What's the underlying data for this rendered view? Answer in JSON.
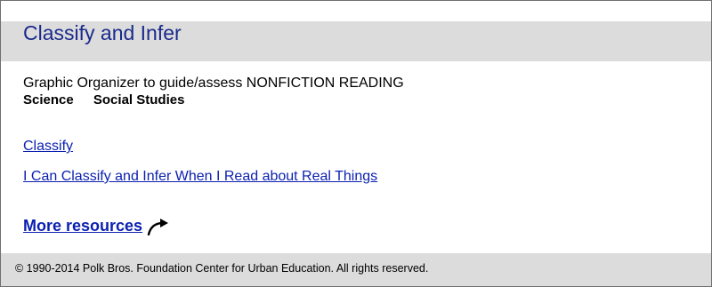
{
  "header": {
    "title": "Classify and Infer"
  },
  "main": {
    "subtitle": "Graphic Organizer to guide/assess NONFICTION READING",
    "subjects": [
      "Science",
      "Social Studies"
    ],
    "links": [
      "Classify",
      "I Can Classify and Infer When I Read about Real Things"
    ],
    "more_resources": {
      "label": "More resources",
      "icon": "curved-arrow-icon"
    }
  },
  "footer": {
    "copyright": "© 1990-2014 Polk Bros. Foundation Center for Urban Education. All rights reserved."
  }
}
